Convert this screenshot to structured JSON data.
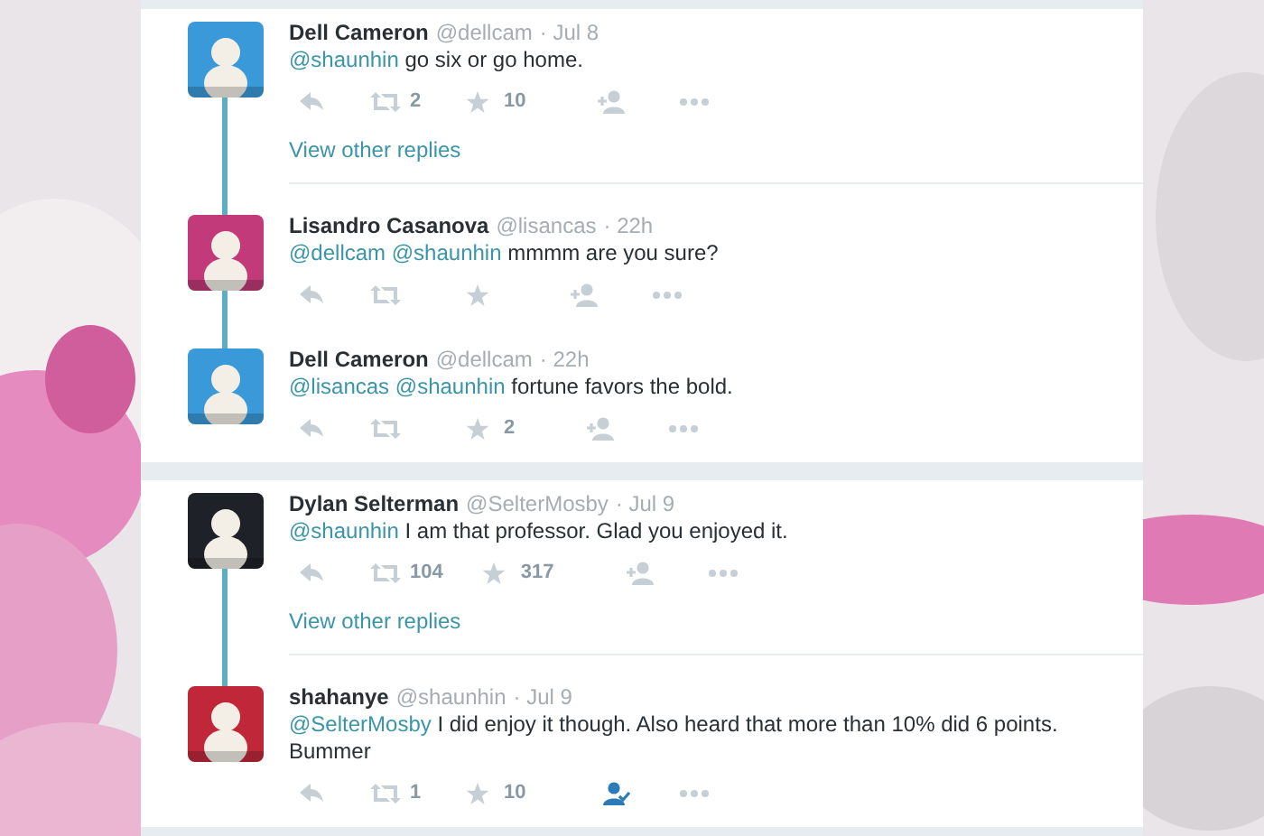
{
  "threads": [
    {
      "items": [
        {
          "kind": "tweet",
          "name": "Dell Cameron",
          "handle": "@dellcam",
          "time": "· Jul 8",
          "mentions": [
            "@shaunhin"
          ],
          "text": "go six or go home.",
          "color": "#3a9ad9",
          "retweets": "2",
          "favorites": "10",
          "following": false
        },
        {
          "kind": "more_link",
          "text": "View other replies"
        },
        {
          "kind": "tweet",
          "name": "Lisandro Casanova",
          "handle": "@lisancas",
          "time": "· 22h",
          "mentions": [
            "@dellcam",
            "@shaunhin"
          ],
          "text": "mmmm are you sure?",
          "color": "#c23a7a",
          "following": false
        },
        {
          "kind": "tweet",
          "name": "Dell Cameron",
          "handle": "@dellcam",
          "time": "· 22h",
          "mentions": [
            "@lisancas",
            "@shaunhin"
          ],
          "text": "fortune favors the bold.",
          "color": "#3a9ad9",
          "favorites": "2",
          "following": false
        }
      ]
    },
    {
      "items": [
        {
          "kind": "tweet",
          "name": "Dylan Selterman",
          "handle": "@SelterMosby",
          "time": "· Jul 9",
          "mentions": [
            "@shaunhin"
          ],
          "text": "I am that professor. Glad you enjoyed it.",
          "color": "#1e2127",
          "retweets": "104",
          "favorites": "317",
          "following": false
        },
        {
          "kind": "more_link",
          "text": "View other replies"
        },
        {
          "kind": "tweet",
          "name": "shahanye",
          "handle": "@shaunhin",
          "time": "· Jul 9",
          "mentions": [
            "@SelterMosby"
          ],
          "text": "I did enjoy it though. Also heard that more than 10% did 6 points. Bummer",
          "color": "#c0283a",
          "retweets": "1",
          "favorites": "10",
          "following": true
        }
      ]
    }
  ]
}
